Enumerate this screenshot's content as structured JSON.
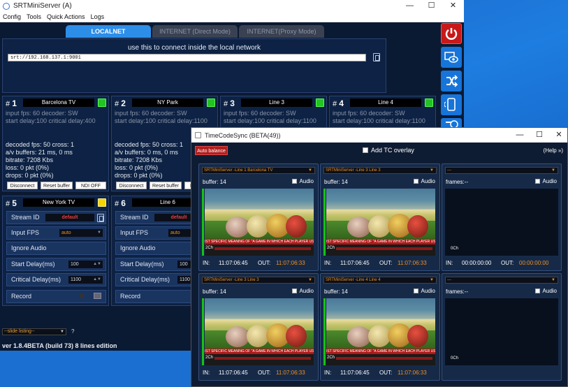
{
  "main_window": {
    "title": "SRTMiniServer (A)",
    "minimize": "—",
    "maximize": "☐",
    "close": "✕",
    "menu": [
      "Config",
      "Tools",
      "Quick Actions",
      "Logs"
    ],
    "tabs": [
      "LOCALNET",
      "INTERNET (Direct Mode)",
      "INTERNET(Proxy Mode)"
    ],
    "connect_hint": "use this to connect inside the local network",
    "connect_url": "srt://192.168.137.1:9001",
    "side_icons": [
      "power-icon",
      "preview-eye-icon",
      "shuffle-icon",
      "tablet-icon",
      "clock-icon"
    ],
    "streams": [
      {
        "num": "1",
        "name": "Barcelona TV",
        "info1": "input fps: 60  decoder: SW",
        "info2": "start delay:100  critical delay:400"
      },
      {
        "num": "2",
        "name": "NY Park",
        "info1": "input fps: 60  decoder: SW",
        "info2": "start delay:100  critical delay:1100"
      },
      {
        "num": "3",
        "name": "Line 3",
        "info1": "input fps: 60  decoder: SW",
        "info2": "start delay:100  critical delay:1100"
      },
      {
        "num": "4",
        "name": "Line 4",
        "info1": "input fps: 60  decoder: SW",
        "info2": "start delay:100  critical delay:1100"
      }
    ],
    "stats1": [
      "decoded fps: 50  cross: 1",
      "a/v buffers: 21 ms, 0 ms",
      "bitrate: 7208 Kbs",
      "loss: 0 pkt (0%)",
      "drops: 0 pkt (0%)"
    ],
    "stats2": [
      "decoded fps: 50  cross: 1",
      "a/v buffers: 0 ms, 0 ms",
      "bitrate: 7208 Kbs",
      "loss: 0 pkt (0%)",
      "drops: 0 pkt (0%)"
    ],
    "buttons": {
      "disconnect": "Disconnect",
      "reset_buffer": "Reset buffer",
      "ndi_off": "NDI OFF"
    },
    "config_panels": [
      {
        "num": "5",
        "name": "New York TV"
      },
      {
        "num": "6",
        "name": "Line 6"
      }
    ],
    "config_labels": {
      "stream_id": "Stream ID",
      "input_fps": "Input FPS",
      "ignore_audio": "Ignore Audio",
      "start_delay": "Start Delay(ms)",
      "critical_delay": "Critical Delay(ms)",
      "record": "Record"
    },
    "config_values": {
      "stream_id": "default",
      "input_fps": "auto",
      "start_delay": "100",
      "critical_delay": "1100"
    },
    "slide_listing": "--slide listing--",
    "help_q": "?",
    "version": "ver 1.8.4BETA (build 73)   8 lines edition"
  },
  "tc_window": {
    "title": "TimeCodeSync (BETA(49))",
    "minimize": "—",
    "maximize": "☐",
    "close": "✕",
    "auto_balance": "Auto balance",
    "add_tc_overlay": "Add TC overlay",
    "help": "(Help »)",
    "audio_label": "Audio",
    "in_label": "IN:",
    "out_label": "OUT:",
    "caption": "IST SPECIFIC MEANING OF \"A GAME IN WHICH EACH PLAYER USE",
    "ch_label": "2Ch",
    "ch0_label": "0Ch",
    "cells": [
      {
        "source": "SRTMiniServer -Line 1 Barcelona TV",
        "buffer": "buffer: 14",
        "in_time": "11:07:06:45",
        "out_time": "11:07:06:33",
        "has_video": true
      },
      {
        "source": "SRTMiniServer -Line 3 Line 3",
        "buffer": "buffer: 14",
        "in_time": "11:07:06:45",
        "out_time": "11:07:06:33",
        "has_video": true
      },
      {
        "source": "---",
        "buffer": "frames:--",
        "in_time": "00:00:00:00",
        "out_time": "00:00:00:00",
        "has_video": false
      },
      {
        "source": "SRTMiniServer -Line 3 Line 3",
        "buffer": "buffer: 14",
        "in_time": "11:07:06:45",
        "out_time": "11:07:06:33",
        "has_video": true
      },
      {
        "source": "SRTMiniServer -Line 4 Line 4",
        "buffer": "buffer: 14",
        "in_time": "11:07:06:45",
        "out_time": "11:07:06:33",
        "has_video": true
      },
      {
        "source": "---",
        "buffer": "frames:--",
        "in_time": "",
        "out_time": "",
        "has_video": false
      }
    ]
  },
  "colors": {
    "accent": "#2d8ee8",
    "led_green": "#22c422",
    "led_yellow": "#f5d400",
    "timecode_out": "#f09020",
    "auto_balance": "#b02020"
  }
}
